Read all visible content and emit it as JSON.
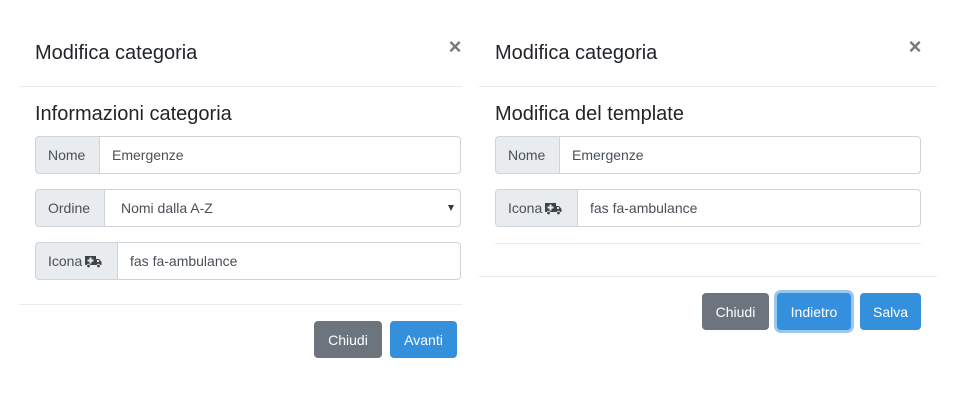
{
  "left_modal": {
    "title": "Modifica categoria",
    "close_symbol": "×",
    "section_title": "Informazioni categoria",
    "name_label": "Nome",
    "name_value": "Emergenze",
    "order_label": "Ordine",
    "order_value": "Nomi dalla A-Z",
    "icon_label": "Icona",
    "icon_value": "fas fa-ambulance",
    "close_button": "Chiudi",
    "next_button": "Avanti"
  },
  "right_modal": {
    "title": "Modifica categoria",
    "close_symbol": "×",
    "section_title": "Modifica del template",
    "name_label": "Nome",
    "name_value": "Emergenze",
    "icon_label": "Icona",
    "icon_value": "fas fa-ambulance",
    "close_button": "Chiudi",
    "back_button": "Indietro",
    "save_button": "Salva"
  },
  "icons": {
    "close": "close-icon",
    "ambulance": "ambulance-icon",
    "select": "chevron-down-icon"
  },
  "colors": {
    "primary": "#3490dc",
    "secondary": "#6c757d",
    "addon_bg": "#e9ecef",
    "border": "#ced4da"
  }
}
